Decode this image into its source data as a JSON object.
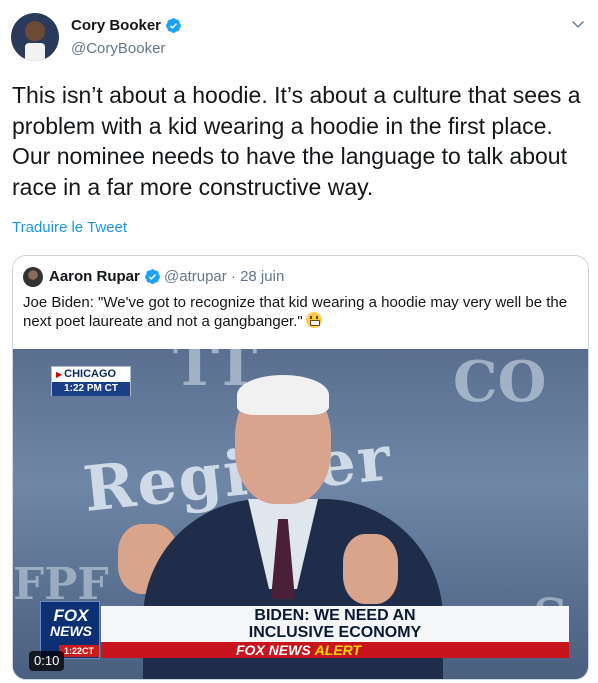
{
  "tweet": {
    "author_name": "Cory Booker",
    "author_handle": "@CoryBooker",
    "text_lines": [
      "This isn’t about a hoodie. It’s about a culture that sees a",
      "problem with a kid wearing a hoodie in the first place.",
      "Our nominee needs to have the language to talk about",
      "race in a far more constructive way."
    ],
    "translate_label": "Traduire le Tweet",
    "icons": {
      "verified": "verified-badge-icon",
      "menu": "chevron-down-icon"
    },
    "colors": {
      "link": "#1b95e0",
      "secondary": "#657786",
      "verified": "#1da1f2"
    }
  },
  "quote": {
    "author_name": "Aaron Rupar",
    "author_handle": "@atrupar · 28 juin",
    "text_line1": "Joe Biden: \"We've got to recognize that kid wearing a hoodie may very well be the",
    "text_line2": "next poet laureate and not a gangbanger.\"",
    "emoji": "grimacing-face-emoji",
    "video": {
      "location": "CHICAGO",
      "local_time": "1:22 PM CT",
      "banner_top_left": "TT",
      "banner_top_right": "CO",
      "banner_main": "Register",
      "banner_bottom_left": "FPF",
      "banner_bottom_right": "S",
      "channel_logo_line1": "FOX",
      "channel_logo_line2": "NEWS",
      "channel_clock": "1:22CT",
      "headline_line1": "BIDEN: WE NEED AN",
      "headline_line2": "INCLUSIVE ECONOMY",
      "alert_part1": "FOX NEWS",
      "alert_part2": "ALERT",
      "elapsed": "0:10"
    }
  }
}
